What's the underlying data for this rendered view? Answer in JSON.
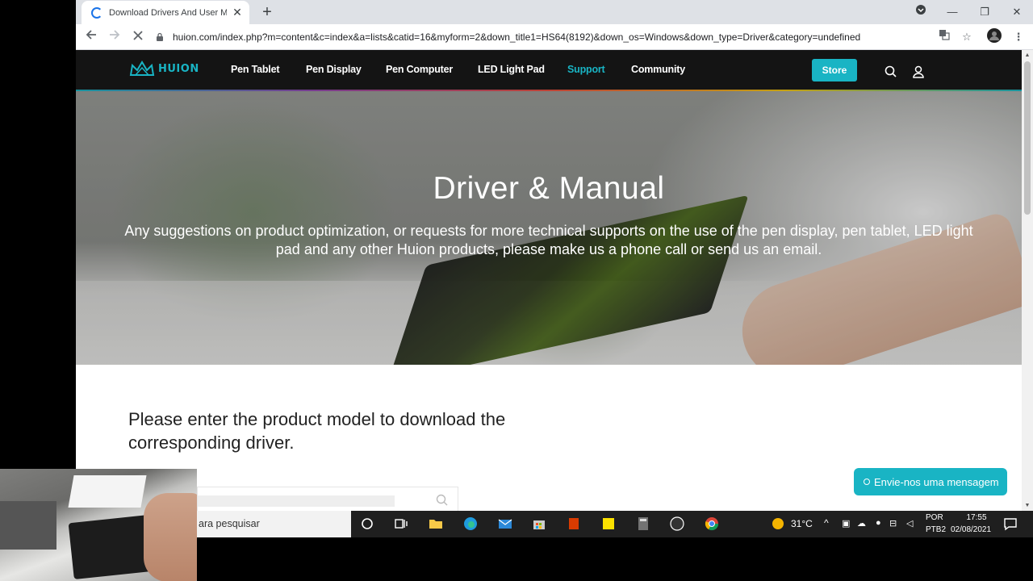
{
  "browser": {
    "tab_title": "Download Drivers And User Man",
    "url": "huion.com/index.php?m=content&c=index&a=lists&catid=16&myform=2&down_title1=HS64(8192)&down_os=Windows&down_type=Driver&category=undefined"
  },
  "site": {
    "logo": "HUION",
    "nav": [
      "Pen Tablet",
      "Pen Display",
      "Pen Computer",
      "LED Light Pad",
      "Support",
      "Community"
    ],
    "active_nav": "Support",
    "store_label": "Store",
    "accent_color": "#19b4c4"
  },
  "hero": {
    "title": "Driver & Manual",
    "description": "Any suggestions on product optimization, or requests for more technical supports on the use of the pen display, pen tablet, LED light pad and any other Huion products, please make us a phone call or send us an email."
  },
  "content": {
    "prompt": "Please enter the product model to download the corresponding driver."
  },
  "chat": {
    "label": "Envie-nos uma mensagem"
  },
  "taskbar": {
    "search_placeholder": "ara pesquisar",
    "weather": "31°C",
    "lang_top": "POR",
    "lang_bottom": "PTB2",
    "time": "17:55",
    "date": "02/08/2021"
  }
}
